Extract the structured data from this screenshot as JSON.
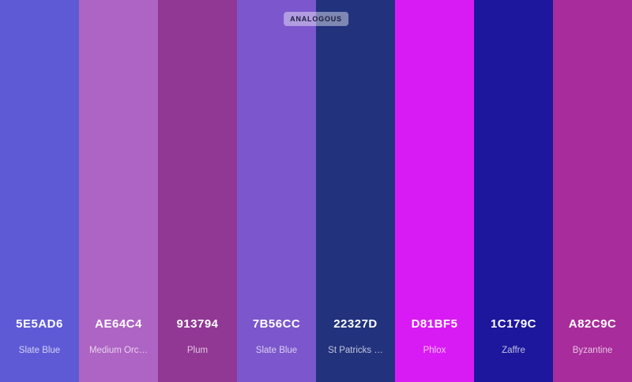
{
  "badge": "ANALOGOUS",
  "swatches": [
    {
      "hex": "5E5AD6",
      "name": "Slate Blue",
      "color": "#5E5AD6"
    },
    {
      "hex": "AE64C4",
      "name": "Medium Orc…",
      "color": "#AE64C4"
    },
    {
      "hex": "913794",
      "name": "Plum",
      "color": "#913794"
    },
    {
      "hex": "7B56CC",
      "name": "Slate Blue",
      "color": "#7B56CC"
    },
    {
      "hex": "22327D",
      "name": "St Patricks …",
      "color": "#22327D"
    },
    {
      "hex": "D81BF5",
      "name": "Phlox",
      "color": "#D81BF5"
    },
    {
      "hex": "1C179C",
      "name": "Zaffre",
      "color": "#1C179C"
    },
    {
      "hex": "A82C9C",
      "name": "Byzantine",
      "color": "#A82C9C"
    }
  ]
}
